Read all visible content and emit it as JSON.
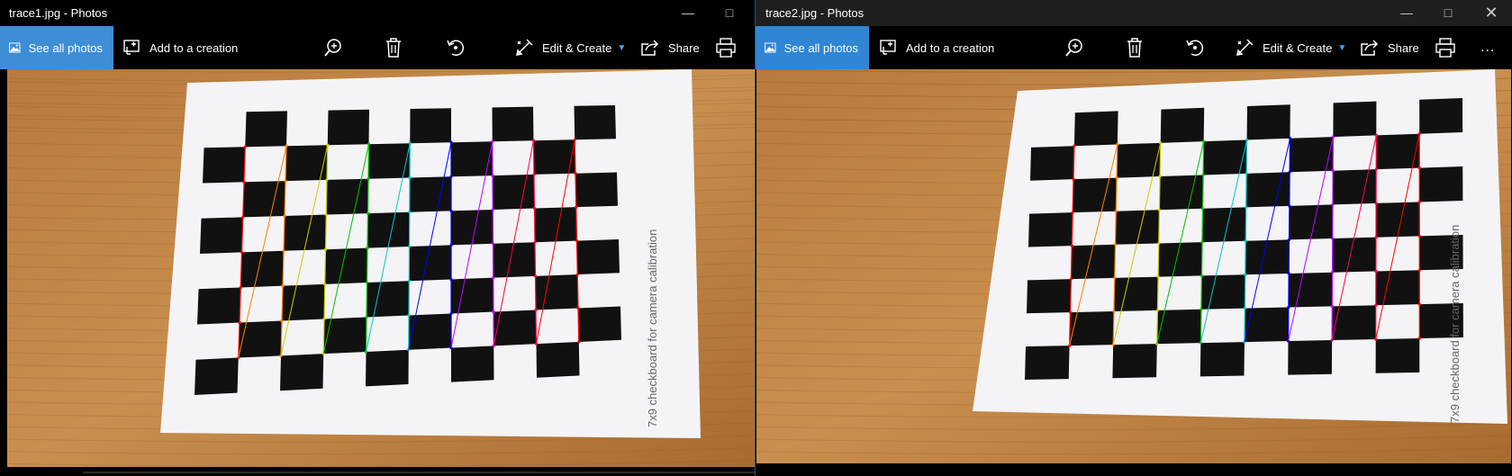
{
  "windows": [
    {
      "title": "trace1.jpg - Photos",
      "toolbar": {
        "see_all": "See all photos",
        "add_creation": "Add to a creation",
        "edit_create": "Edit & Create",
        "share": "Share"
      },
      "board_caption": "7x9 checkboard for camera calibration"
    },
    {
      "title": "trace2.jpg - Photos",
      "toolbar": {
        "see_all": "See all photos",
        "add_creation": "Add to a creation",
        "edit_create": "Edit & Create",
        "share": "Share",
        "more": "..."
      },
      "board_caption": "7x9 checkboard for camera calibration"
    }
  ],
  "icons": {
    "minimize": "minimize-icon",
    "maximize": "maximize-icon",
    "close": "close-icon",
    "photos": "image-icon",
    "creation": "add-to-creation-icon",
    "zoom": "zoom-in-icon",
    "delete": "trash-icon",
    "rotate": "rotate-icon",
    "edit": "edit-create-icon",
    "share": "share-icon",
    "print": "print-icon"
  },
  "colors": {
    "accent": "#3d8ed7",
    "trace_lines": [
      "#ff0000",
      "#ff8000",
      "#c8d000",
      "#00c000",
      "#00c8c8",
      "#0000ff",
      "#c000ff",
      "#ff0040"
    ]
  }
}
